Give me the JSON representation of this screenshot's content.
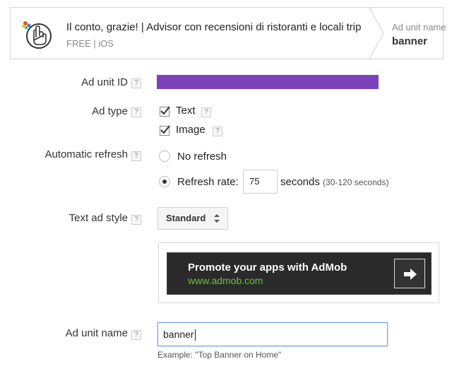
{
  "header": {
    "app_title": "Il conto, grazie! | Advisor con recensioni di ristoranti e locali trip",
    "app_subtitle": "FREE | iOS",
    "adunit_label": "Ad unit name",
    "adunit_value": "banner"
  },
  "form": {
    "ad_unit_id_label": "Ad unit ID",
    "ad_type_label": "Ad type",
    "ad_type_text": "Text",
    "ad_type_image": "Image",
    "refresh_label": "Automatic refresh",
    "no_refresh": "No refresh",
    "refresh_rate": "Refresh rate:",
    "refresh_value": "75",
    "seconds": "seconds",
    "seconds_range": "(30-120 seconds)",
    "text_style_label": "Text ad style",
    "text_style_value": "Standard",
    "ad_preview_headline": "Promote your apps with AdMob",
    "ad_preview_url": "www.admob.com",
    "ad_unit_name_label": "Ad unit name",
    "ad_unit_name_value": "banner",
    "example": "Example: \"Top Banner on Home\"",
    "help_glyph": "?"
  },
  "colors": {
    "ad_unit_id_bar": "#7b42ba",
    "ad_bg": "#2a2a2a",
    "ad_url": "#6fbf3c",
    "focus": "#6d9eeb"
  }
}
